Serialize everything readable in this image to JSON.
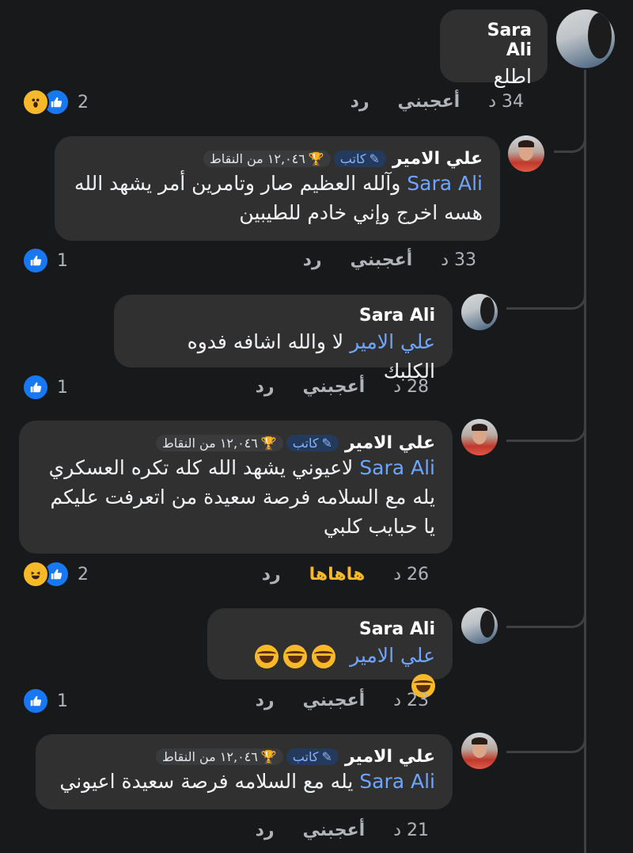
{
  "top_comment": {
    "author": "Sara Ali",
    "text": "اطلع",
    "time": "34 د",
    "like_label": "أعجبني",
    "reply_label": "رد",
    "reaction_count": "2"
  },
  "replies": [
    {
      "author": "علي الامير",
      "badge_author": "كاتب",
      "badge_points": "١٢,٠٤٦ من النقاط",
      "mention": "Sara Ali",
      "text_line1": " وآلله العظيم صار وتامرين أمر يشهد الله",
      "text_line2": "هسه اخرج وإني خادم للطيبين",
      "time": "33 د",
      "like_label": "أعجبني",
      "reply_label": "رد",
      "reaction_count": "1"
    },
    {
      "author": "Sara Ali",
      "mention": "علي الامير",
      "text_line1": " لا والله اشافه فدوه الكلبك",
      "time": "28 د",
      "like_label": "أعجبني",
      "reply_label": "رد",
      "reaction_count": "1"
    },
    {
      "author": "علي الامير",
      "badge_author": "كاتب",
      "badge_points": "١٢,٠٤٦ من النقاط",
      "mention": "Sara Ali",
      "text_line1": " لاعيوني يشهد الله كله تكره العسكري",
      "text_line2": "يله مع السلامه فرصة سعيدة من اتعرفت عليكم",
      "text_line3": "يا حبايب كلبي",
      "time": "26 د",
      "like_label": "هاهاها",
      "reply_label": "رد",
      "reaction_count": "2"
    },
    {
      "author": "Sara Ali",
      "mention": "علي الامير",
      "time": "23 د",
      "like_label": "أعجبني",
      "reply_label": "رد",
      "reaction_count": "1"
    },
    {
      "author": "علي الامير",
      "badge_author": "كاتب",
      "badge_points": "١٢,٠٤٦ من النقاط",
      "mention": "Sara Ali",
      "text_line1": " يله مع السلامه فرصة سعيدة اعيوني",
      "time": "21 د",
      "like_label": "أعجبني",
      "reply_label": "رد"
    }
  ],
  "colors": {
    "background": "#18191a",
    "bubble": "#303031",
    "mention": "#6ea6ff",
    "like_blue": "#1877f2",
    "haha_yellow": "#f7b928"
  }
}
